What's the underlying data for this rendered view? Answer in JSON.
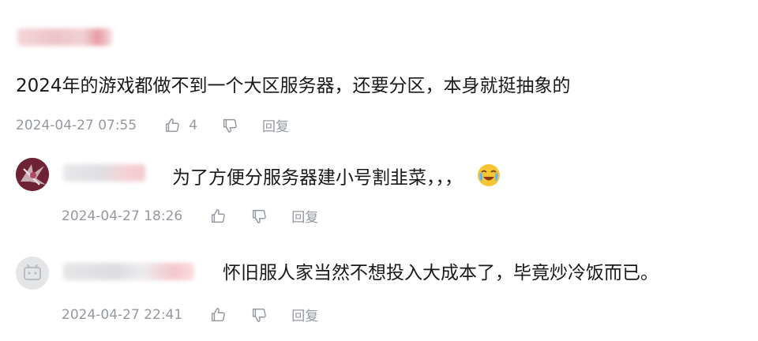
{
  "comments": [
    {
      "text": "2024年的游戏都做不到一个大区服务器，还要分区，本身就挺抽象的",
      "timestamp": "2024-04-27 07:55",
      "like_count": "4",
      "reply_label": "回复"
    },
    {
      "text": "为了方便分服务器建小号割韭菜，，，",
      "timestamp": "2024-04-27 18:26",
      "reply_label": "回复",
      "emoji": "crying-laugh-emoji"
    },
    {
      "text": "怀旧服人家当然不想投入大成本了，毕竟炒冷饭而已。",
      "timestamp": "2024-04-27 22:41",
      "reply_label": "回复"
    }
  ],
  "icons": {
    "like": "thumb-up-icon",
    "dislike": "thumb-down-icon"
  },
  "colors": {
    "meta_text": "#9499a0",
    "blur_pink": "#f5a5b0",
    "avatar2_bg": "#7a2a3a",
    "avatar3_bg": "#e3e5e7"
  }
}
